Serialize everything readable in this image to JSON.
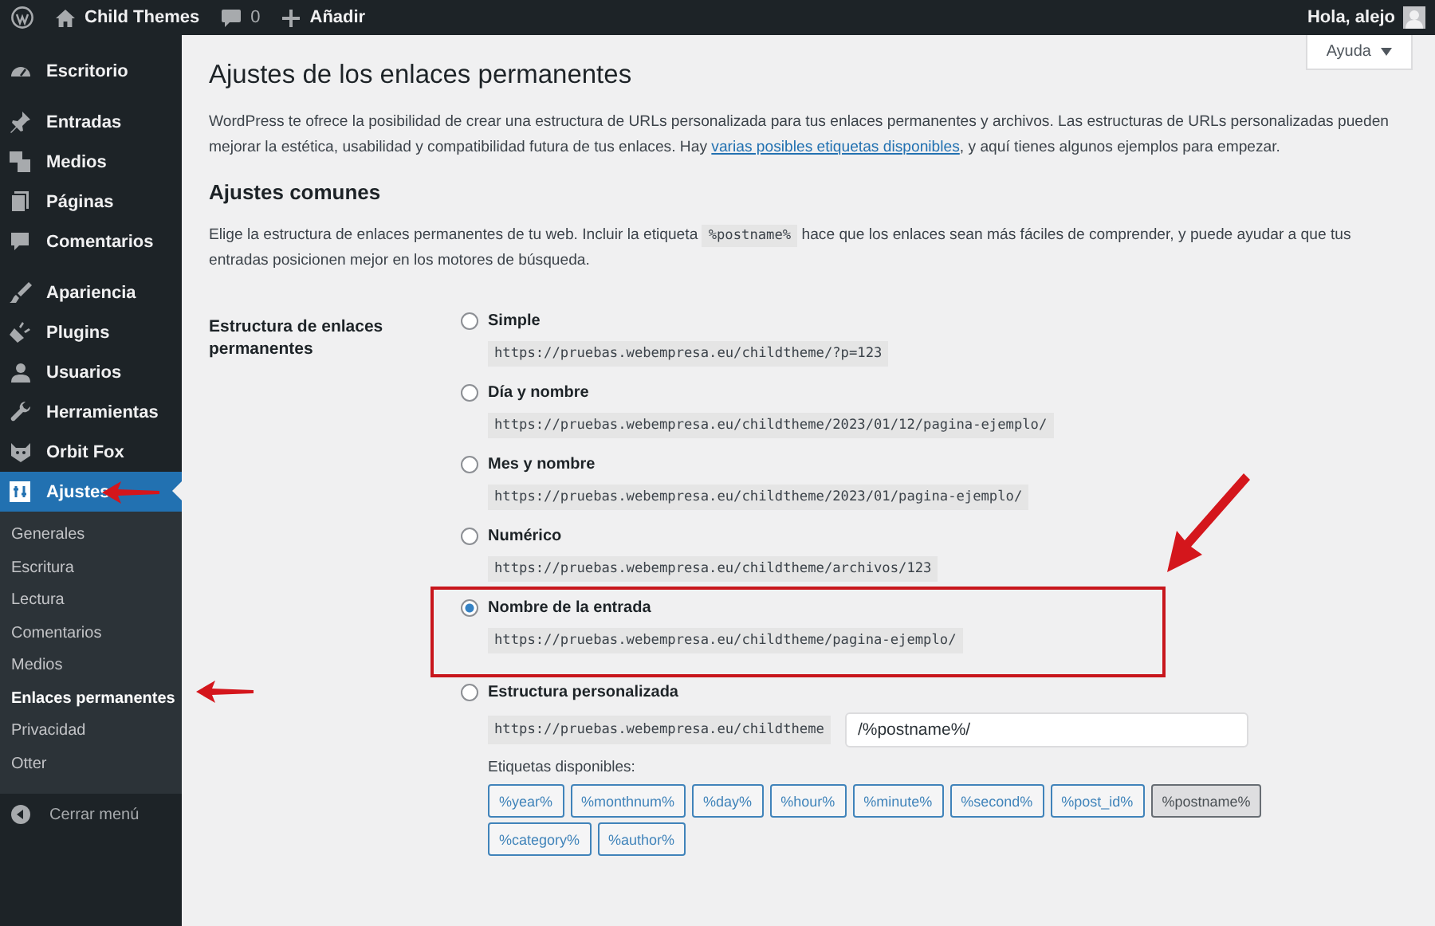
{
  "admin_bar": {
    "site": "Child Themes",
    "comments": "0",
    "new": "Añadir",
    "greeting": "Hola, alejo"
  },
  "sidebar": {
    "items": [
      {
        "label": "Escritorio",
        "selected": false,
        "annotated": false
      },
      {
        "label": "Entradas",
        "selected": false,
        "annotated": false
      },
      {
        "label": "Medios",
        "selected": false,
        "annotated": false
      },
      {
        "label": "Páginas",
        "selected": false,
        "annotated": false
      },
      {
        "label": "Comentarios",
        "selected": false,
        "annotated": false
      },
      {
        "label": "Apariencia",
        "selected": false,
        "annotated": false
      },
      {
        "label": "Plugins",
        "selected": false,
        "annotated": false
      },
      {
        "label": "Usuarios",
        "selected": false,
        "annotated": false
      },
      {
        "label": "Herramientas",
        "selected": false,
        "annotated": false
      },
      {
        "label": "Orbit Fox",
        "selected": false,
        "annotated": false
      },
      {
        "label": "Ajustes",
        "selected": true,
        "annotated": true
      }
    ],
    "submenu": [
      {
        "label": "Generales",
        "selected": false,
        "annotated": false
      },
      {
        "label": "Escritura",
        "selected": false,
        "annotated": false
      },
      {
        "label": "Lectura",
        "selected": false,
        "annotated": false
      },
      {
        "label": "Comentarios",
        "selected": false,
        "annotated": false
      },
      {
        "label": "Medios",
        "selected": false,
        "annotated": false
      },
      {
        "label": "Enlaces permanentes",
        "selected": true,
        "annotated": true
      },
      {
        "label": "Privacidad",
        "selected": false,
        "annotated": false
      },
      {
        "label": "Otter",
        "selected": false,
        "annotated": false
      }
    ],
    "collapse": "Cerrar menú"
  },
  "help_button": "Ayuda",
  "page": {
    "title": "Ajustes de los enlaces permanentes",
    "intro": "WordPress te ofrece la posibilidad de crear una estructura de URLs personalizada para tus enlaces permanentes y archivos. Las estructuras de URLs personalizadas pueden mejorar la estética, usabilidad y compatibilidad futura de tus enlaces. Hay ",
    "intro_link": "varias posibles etiquetas disponibles",
    "intro_end": ", y aquí tienes algunos ejemplos para empezar.",
    "section_title": "Ajustes comunes",
    "section_text_1": "Elige la estructura de enlaces permanentes de tu web. Incluir la etiqueta ",
    "section_code": "%postname%",
    "section_text_2": " hace que los enlaces sean más fáciles de comprender, y puede ayudar a que tus entradas posicionen mejor en los motores de búsqueda.",
    "field_label": "Estructura de enlaces permanentes",
    "options": [
      {
        "label": "Simple",
        "example": "https://pruebas.webempresa.eu/childtheme/?p=123",
        "selected": false,
        "highlighted": false
      },
      {
        "label": "Día y nombre",
        "example": "https://pruebas.webempresa.eu/childtheme/2023/01/12/pagina-ejemplo/",
        "selected": false,
        "highlighted": false
      },
      {
        "label": "Mes y nombre",
        "example": "https://pruebas.webempresa.eu/childtheme/2023/01/pagina-ejemplo/",
        "selected": false,
        "highlighted": false
      },
      {
        "label": "Numérico",
        "example": "https://pruebas.webempresa.eu/childtheme/archivos/123",
        "selected": false,
        "highlighted": false
      },
      {
        "label": "Nombre de la entrada",
        "example": "https://pruebas.webempresa.eu/childtheme/pagina-ejemplo/",
        "selected": true,
        "highlighted": true
      }
    ],
    "custom": {
      "label": "Estructura personalizada",
      "selected": false,
      "prefix": "https://pruebas.webempresa.eu/childtheme",
      "value": "/%postname%/",
      "tags_label": "Etiquetas disponibles:",
      "tags": [
        {
          "label": "%year%",
          "selected": false
        },
        {
          "label": "%monthnum%",
          "selected": false
        },
        {
          "label": "%day%",
          "selected": false
        },
        {
          "label": "%hour%",
          "selected": false
        },
        {
          "label": "%minute%",
          "selected": false
        },
        {
          "label": "%second%",
          "selected": false
        },
        {
          "label": "%post_id%",
          "selected": false
        },
        {
          "label": "%postname%",
          "selected": true
        },
        {
          "label": "%category%",
          "selected": false
        },
        {
          "label": "%author%",
          "selected": false
        }
      ]
    }
  }
}
